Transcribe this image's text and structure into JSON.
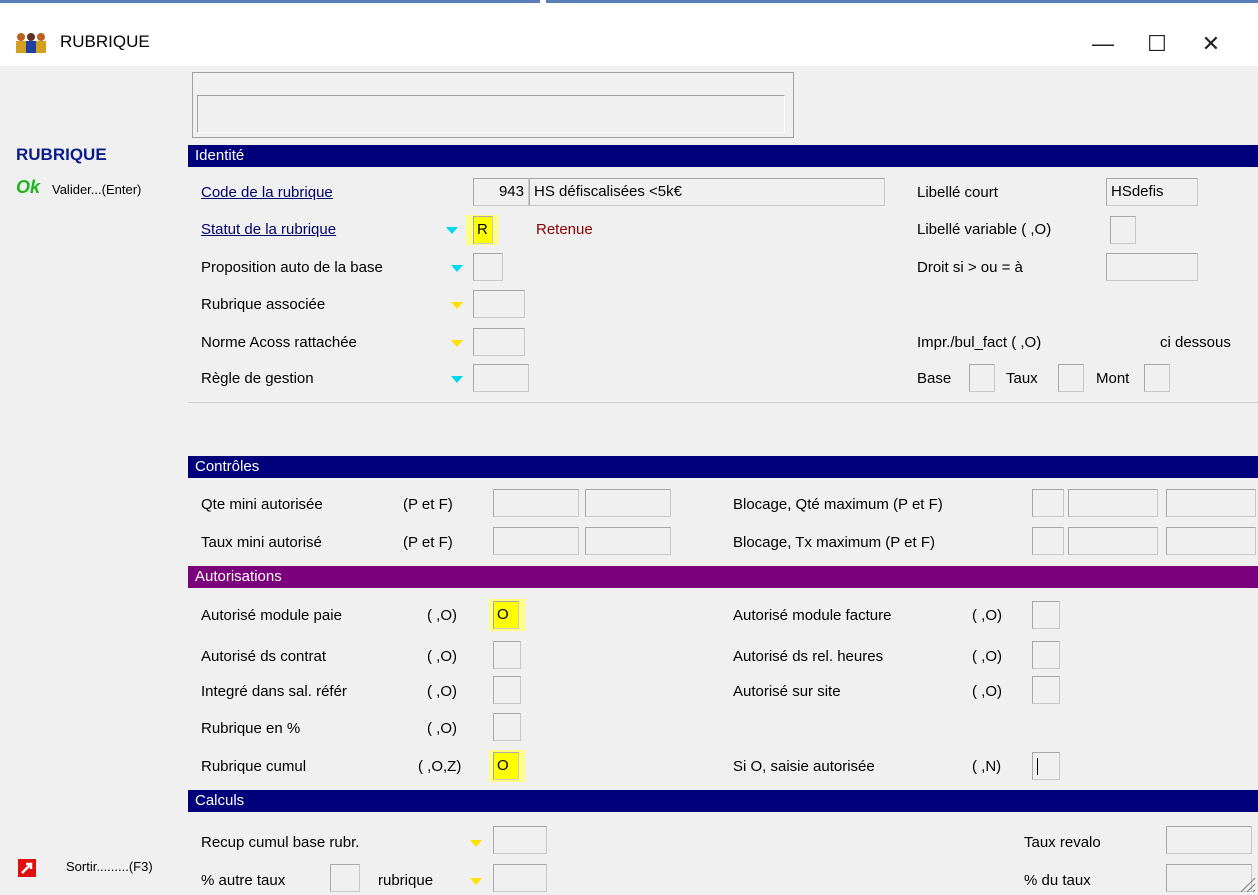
{
  "window": {
    "title": "RUBRIQUE",
    "icons": {
      "app": "users-icon",
      "minimize": "minimize-icon",
      "maximize": "maximize-icon",
      "close": "close-icon"
    },
    "minimize_glyph": "—",
    "maximize_glyph": "☐",
    "close_glyph": "✕"
  },
  "left_panel": {
    "title": "RUBRIQUE",
    "ok_glyph": "Ok",
    "validate_label": "Valider...(Enter)",
    "exit_label": "Sortir.........(F3)"
  },
  "identite": {
    "header": "Identité",
    "code_label": "Code de la rubrique",
    "code_value": "943",
    "code_desc": "HS défiscalisées <5k€",
    "statut_label": "Statut de la rubrique",
    "statut_value": "R",
    "statut_desc": "Retenue",
    "proposition_label": "Proposition auto de la base",
    "associee_label": "Rubrique associée",
    "acoss_label": "Norme Acoss rattachée",
    "regle_label": "Règle de gestion",
    "libelle_court_label": "Libellé court",
    "libelle_court_value": "HSdefis",
    "libelle_variable_label": "Libellé variable ( ,O)",
    "droit_label": "Droit si > ou = à",
    "impr_label": "Impr./bul_fact ( ,O)",
    "ci_dessous_label": "ci dessous",
    "base_label": "Base",
    "taux_label": "Taux",
    "mont_label": "Mont"
  },
  "controles": {
    "header": "Contrôles",
    "qte_mini_label": "Qte  mini autorisée",
    "qte_mini_pf": "(P et F)",
    "taux_mini_label": "Taux mini autorisé",
    "taux_mini_pf": "(P et F)",
    "blocage_qte_label": "Blocage, Qté maximum  (P et F)",
    "blocage_tx_label": "Blocage, Tx maximum   (P et F)"
  },
  "autorisations": {
    "header": "Autorisations",
    "paie_label": "Autorisé module paie",
    "paie_opt": "( ,O)",
    "paie_value": "O",
    "contrat_label": "Autorisé ds contrat",
    "contrat_opt": "( ,O)",
    "integre_label": "Integré dans sal. référ",
    "integre_opt": "( ,O)",
    "pct_label": "Rubrique en %",
    "pct_opt": "( ,O)",
    "cumul_label": "Rubrique cumul",
    "cumul_opt": "( ,O,Z)",
    "cumul_value": "O",
    "facture_label": "Autorisé module facture",
    "facture_opt": "( ,O)",
    "rel_heures_label": "Autorisé ds rel. heures",
    "rel_heures_opt": "( ,O)",
    "site_label": "Autorisé sur site",
    "site_opt": "( ,O)",
    "saisie_label": "Si O, saisie autorisée",
    "saisie_opt": "( ,N)"
  },
  "calculs": {
    "header": "Calculs",
    "recup_label": "Recup cumul base rubr.",
    "autre_taux_label": "% autre taux",
    "rubrique_label": "rubrique",
    "taux_revalo_label": "Taux revalo",
    "du_taux_label": "% du taux"
  },
  "colors": {
    "section_navy": "#00007b",
    "section_purple": "#7b007b",
    "highlight": "#ffff00",
    "accent_red": "#8b0000"
  }
}
